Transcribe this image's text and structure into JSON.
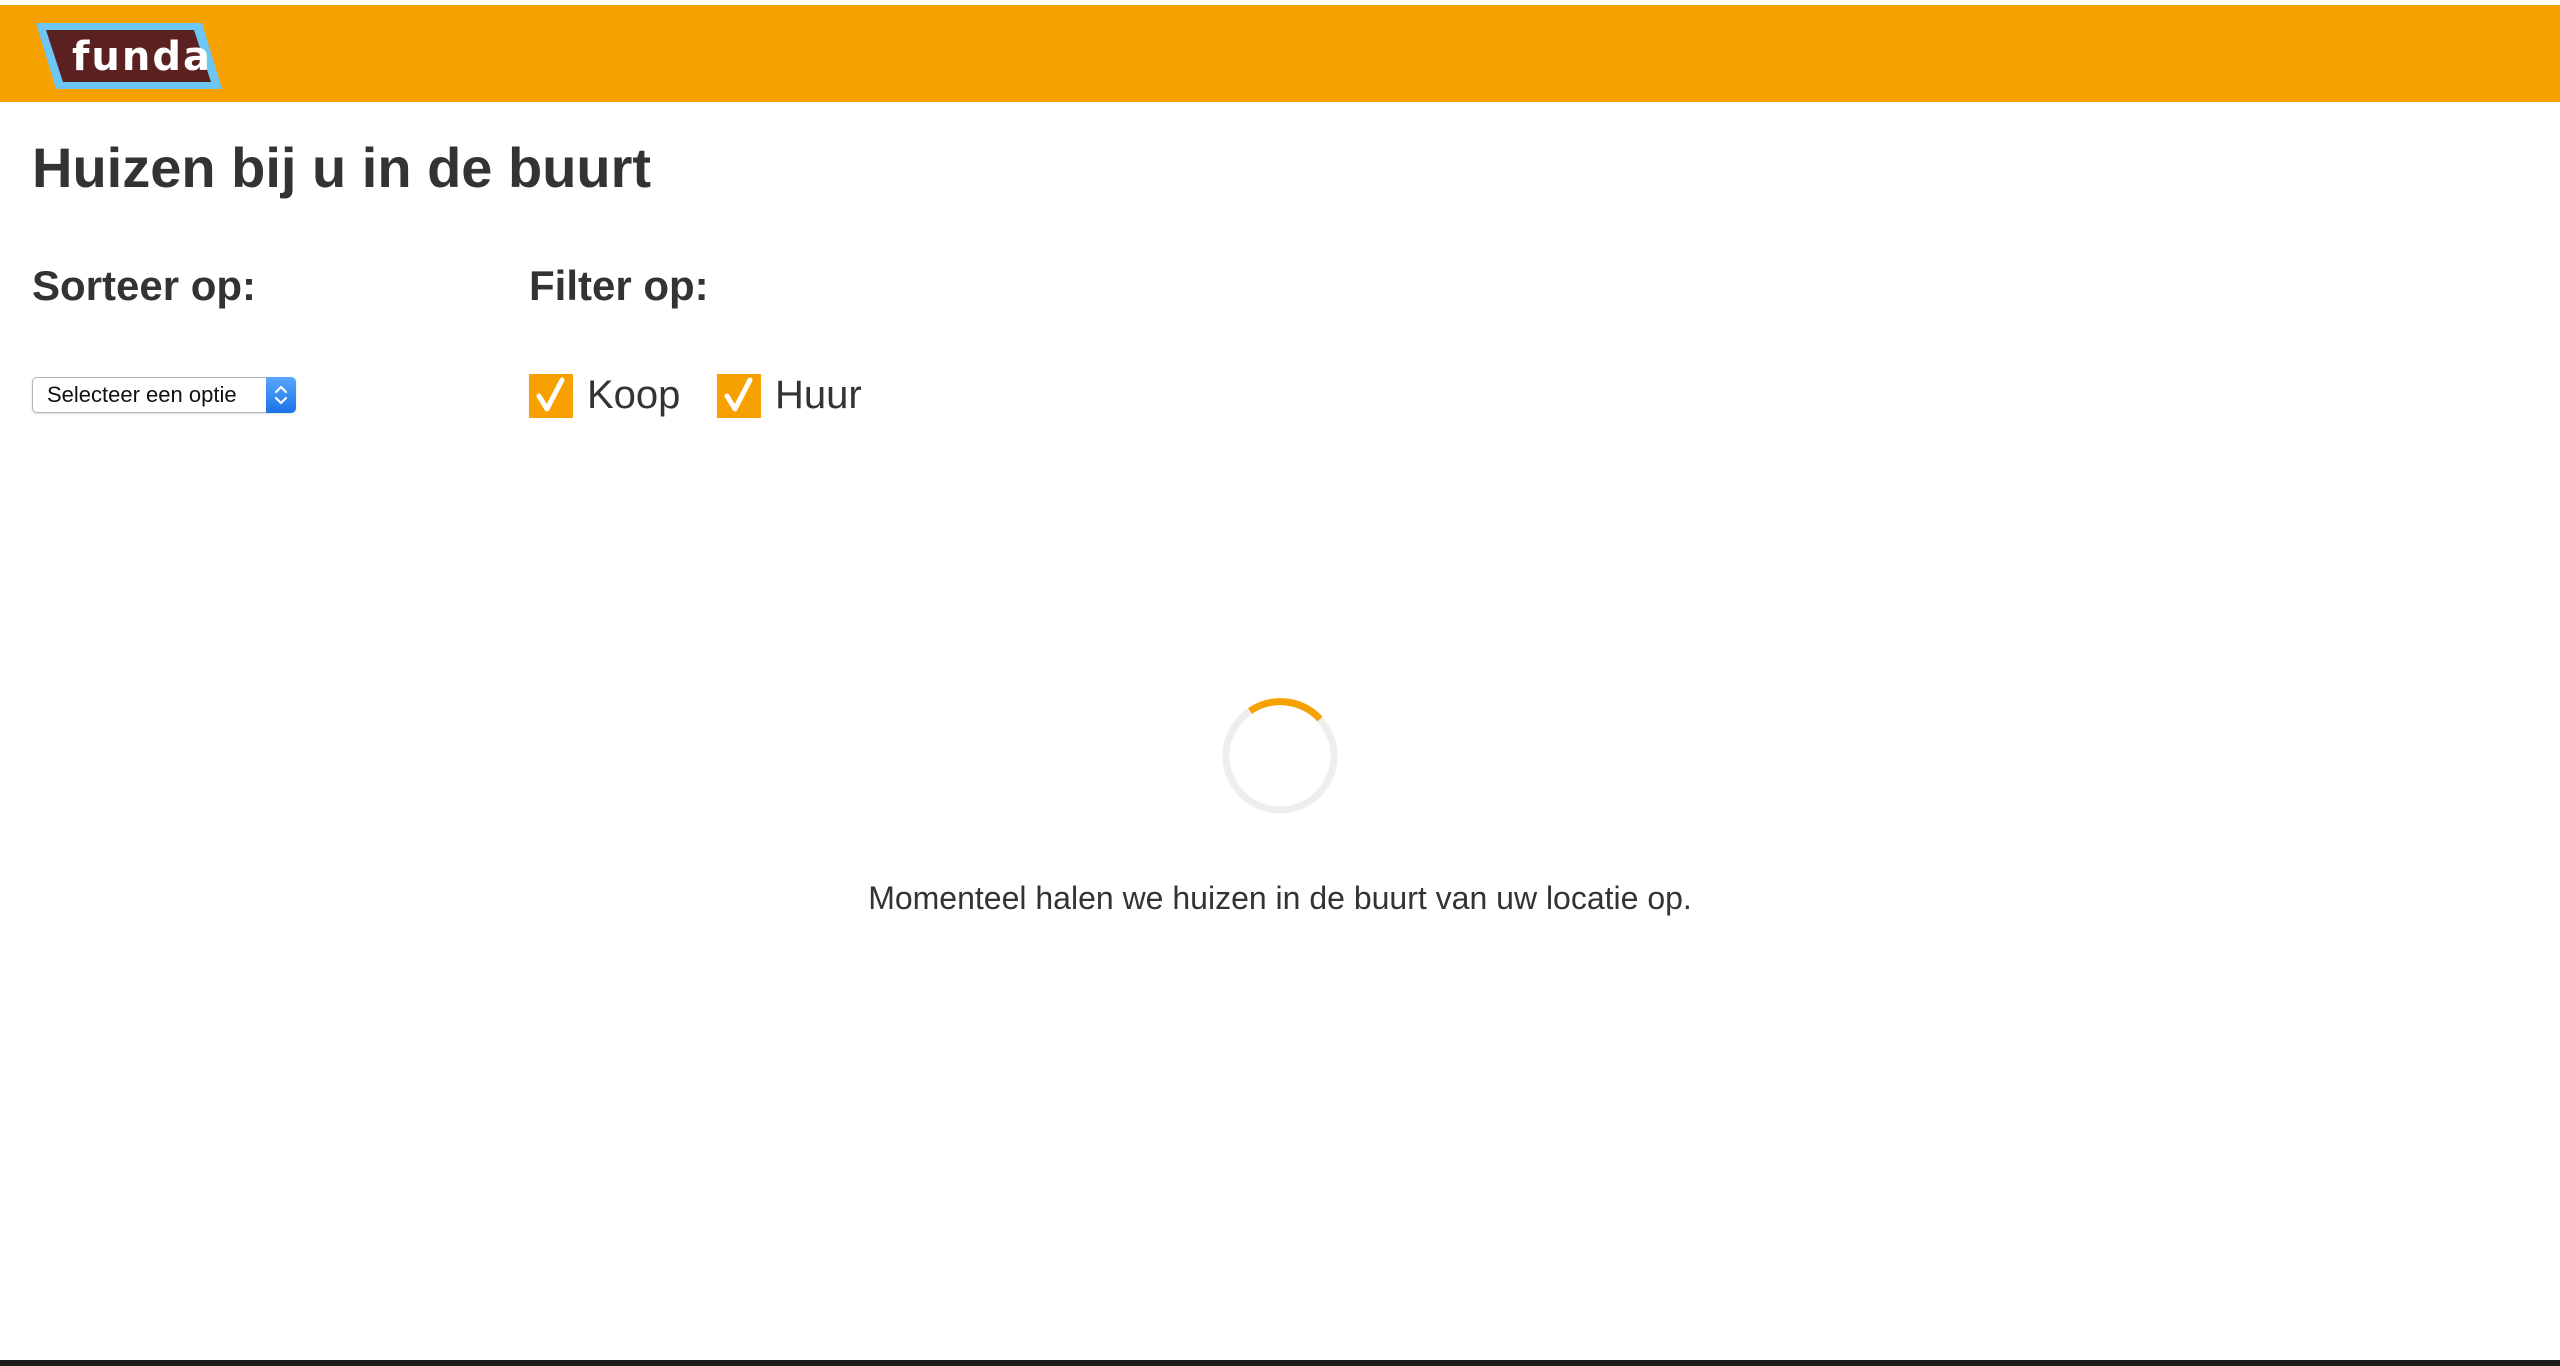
{
  "brand": {
    "logo_text": "funda",
    "header_color": "#f7a100",
    "logo_fill": "#5b2121",
    "logo_border": "#6ec6f2"
  },
  "page": {
    "title": "Huizen bij u in de buurt"
  },
  "sort": {
    "heading": "Sorteer op:",
    "selected_option": "Selecteer een optie"
  },
  "filter": {
    "heading": "Filter op:",
    "options": [
      {
        "label": "Koop",
        "checked": true
      },
      {
        "label": "Huur",
        "checked": true
      }
    ]
  },
  "loading": {
    "message": "Momenteel halen we huizen in de buurt van uw locatie op.",
    "spinner_color": "#f7a100",
    "track_color": "#eeeeee"
  },
  "icons": {
    "spinner": "loading-spinner-icon",
    "checkmark": "checkmark-icon",
    "select_arrows": "chevron-up-down-icon"
  }
}
